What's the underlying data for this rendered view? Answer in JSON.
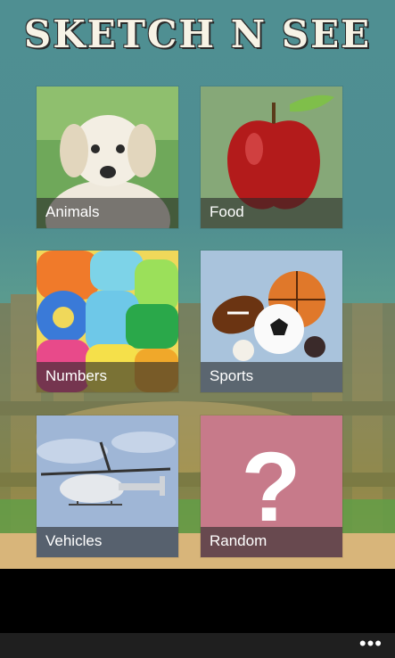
{
  "app": {
    "title": "SKETCH N SEE"
  },
  "categories": [
    {
      "label": "Animals",
      "image": "puppy-photo"
    },
    {
      "label": "Food",
      "image": "apple-photo"
    },
    {
      "label": "Numbers",
      "image": "foam-numbers-photo"
    },
    {
      "label": "Sports",
      "image": "sports-balls-photo"
    },
    {
      "label": "Vehicles",
      "image": "helicopter-photo"
    },
    {
      "label": "Random",
      "image": "question-mark-icon"
    }
  ],
  "colors": {
    "background": "#4f8f92",
    "food_tile": "#86a878",
    "sports_tile": "#a9c3dc",
    "random_tile": "#c77a8a",
    "app_bar": "#1f1f1f"
  },
  "appbar": {
    "more_label": "•••"
  }
}
